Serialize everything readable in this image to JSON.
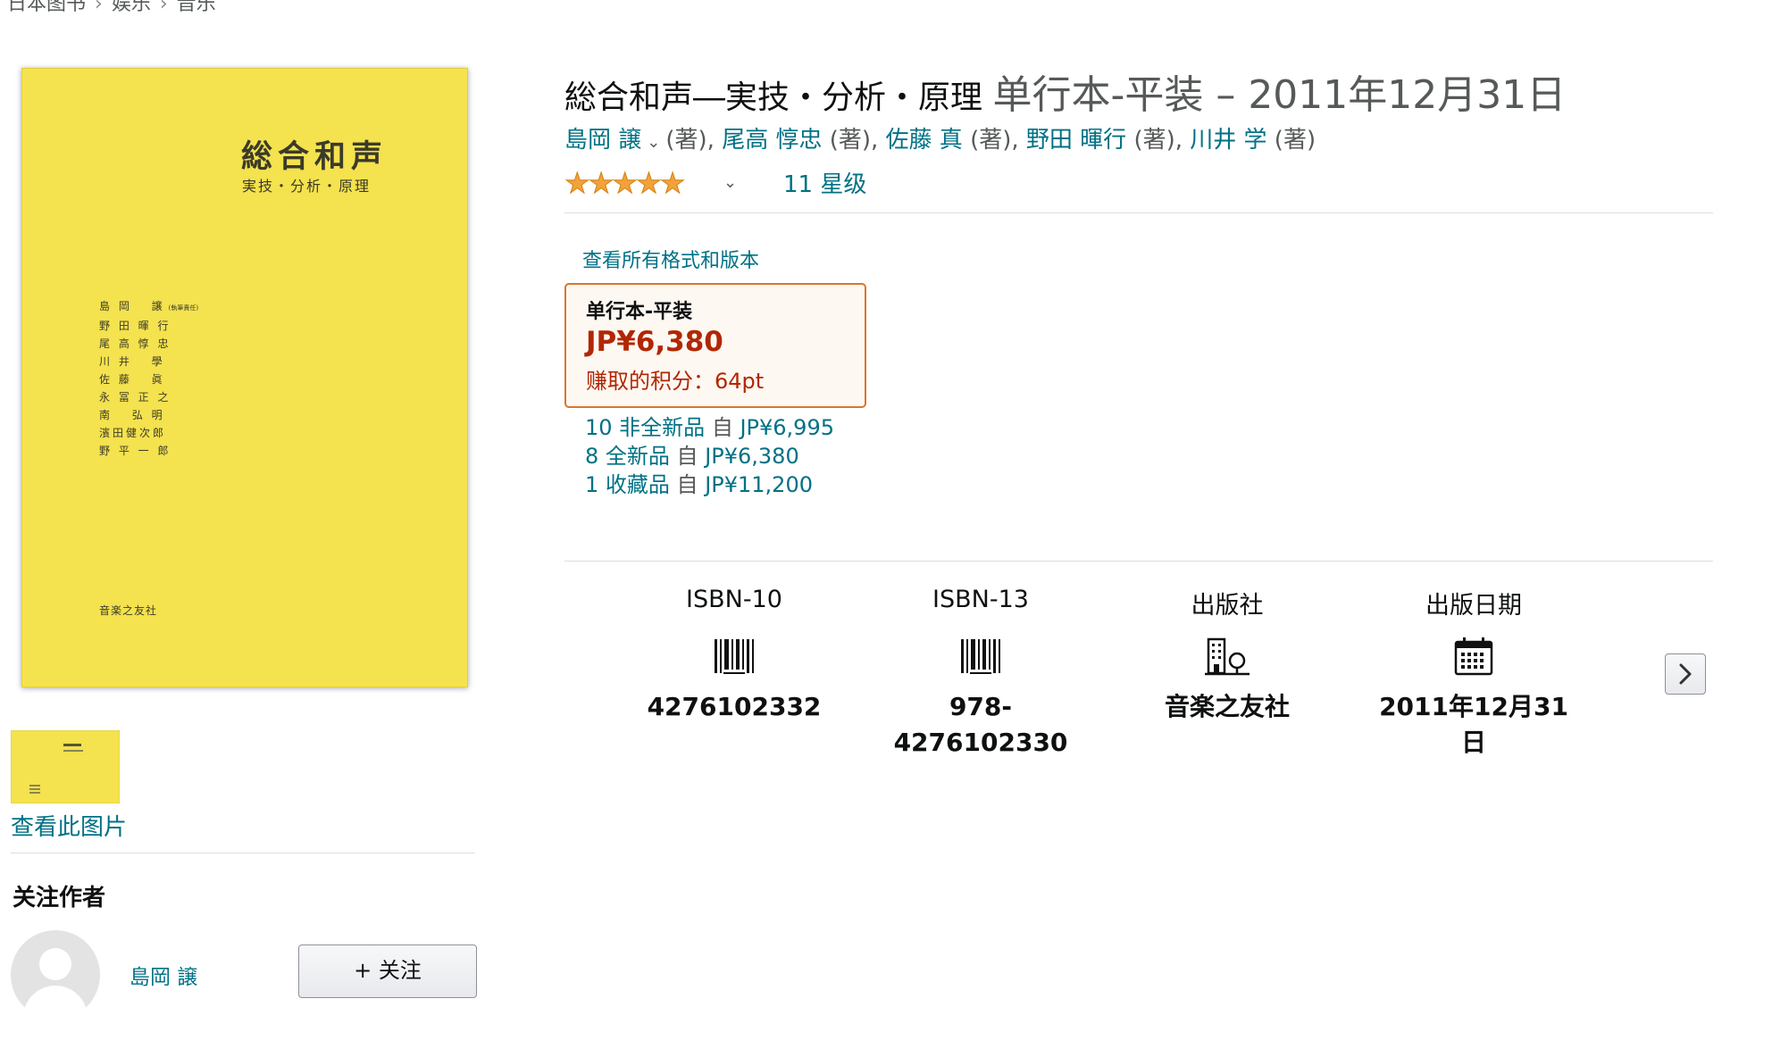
{
  "breadcrumb": [
    "日本图书",
    "娱乐",
    "音乐"
  ],
  "cover": {
    "title": "総合和声",
    "subtitle": "実技・分析・原理",
    "authors": [
      "島 岡　 譲",
      "野 田 暉 行",
      "尾 高 惇 忠",
      "川 井　 學",
      "佐 藤　 眞",
      "永 冨 正 之",
      "南　 弘 明",
      "濱田健次郎",
      "野 平 一 郎"
    ],
    "author_note": "(執筆責任)",
    "publisher": "音楽之友社"
  },
  "left": {
    "view_image": "查看此图片",
    "follow_heading": "关注作者",
    "author_name": "島岡 譲",
    "follow_button": "+ 关注"
  },
  "product": {
    "title": "総合和声―実技・分析・原理",
    "format_date": "单行本-平装 – 2011年12月31日",
    "authors": [
      {
        "name": "島岡 譲",
        "role": "(著),"
      },
      {
        "name": "尾高 惇忠",
        "role": "(著),"
      },
      {
        "name": "佐藤 真",
        "role": "(著),"
      },
      {
        "name": "野田 暉行",
        "role": "(著),"
      },
      {
        "name": "川井 学",
        "role": "(著)"
      }
    ],
    "rating": 5,
    "ratings_count": "11 星级"
  },
  "formats": {
    "see_all": "查看所有格式和版本",
    "selected_name": "单行本-平装",
    "selected_price": "JP¥6,380",
    "selected_points": "赚取的积分：64pt",
    "offers": [
      {
        "count": "10 非全新品",
        "from": "自",
        "price": "JP¥6,995"
      },
      {
        "count": "8 全新品",
        "from": "自",
        "price": "JP¥6,380"
      },
      {
        "count": "1 收藏品",
        "from": "自",
        "price": "JP¥11,200"
      }
    ]
  },
  "details": [
    {
      "label": "ISBN-10",
      "icon": "barcode-icon",
      "value_lines": [
        "4276102332"
      ]
    },
    {
      "label": "ISBN-13",
      "icon": "barcode-icon",
      "value_lines": [
        "978-",
        "4276102330"
      ]
    },
    {
      "label": "出版社",
      "icon": "building-icon",
      "value_lines": [
        "音楽之友社"
      ]
    },
    {
      "label": "出版日期",
      "icon": "calendar-icon",
      "value_lines": [
        "2011年12月31",
        "日"
      ]
    }
  ],
  "colors": {
    "link": "#007185",
    "price": "#b12704",
    "swatch_border": "#d8762c",
    "star": "#f2a23b",
    "cover": "#f4e24e"
  }
}
